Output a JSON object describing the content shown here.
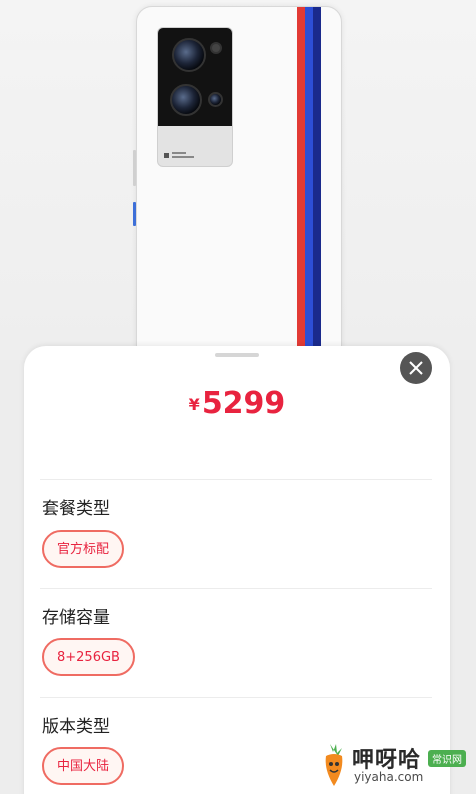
{
  "product": {
    "price_currency": "¥",
    "price_value": "5299"
  },
  "options": {
    "package": {
      "title": "套餐类型",
      "selected": "官方标配"
    },
    "storage": {
      "title": "存储容量",
      "selected": "8+256GB"
    },
    "version": {
      "title": "版本类型",
      "selected": "中国大陆"
    }
  },
  "watermark": {
    "name_cn": "呷呀哈",
    "badge": "常识网",
    "domain": "yiyaha.com"
  },
  "colors": {
    "price_red": "#e8233f",
    "chip_border": "#ef6b62",
    "stripe_red": "#e23a35",
    "stripe_blue": "#2d4fd6",
    "stripe_navy": "#1a2a8c"
  },
  "icons": {
    "close": "close-icon",
    "mascot": "carrot-mascot-icon"
  }
}
